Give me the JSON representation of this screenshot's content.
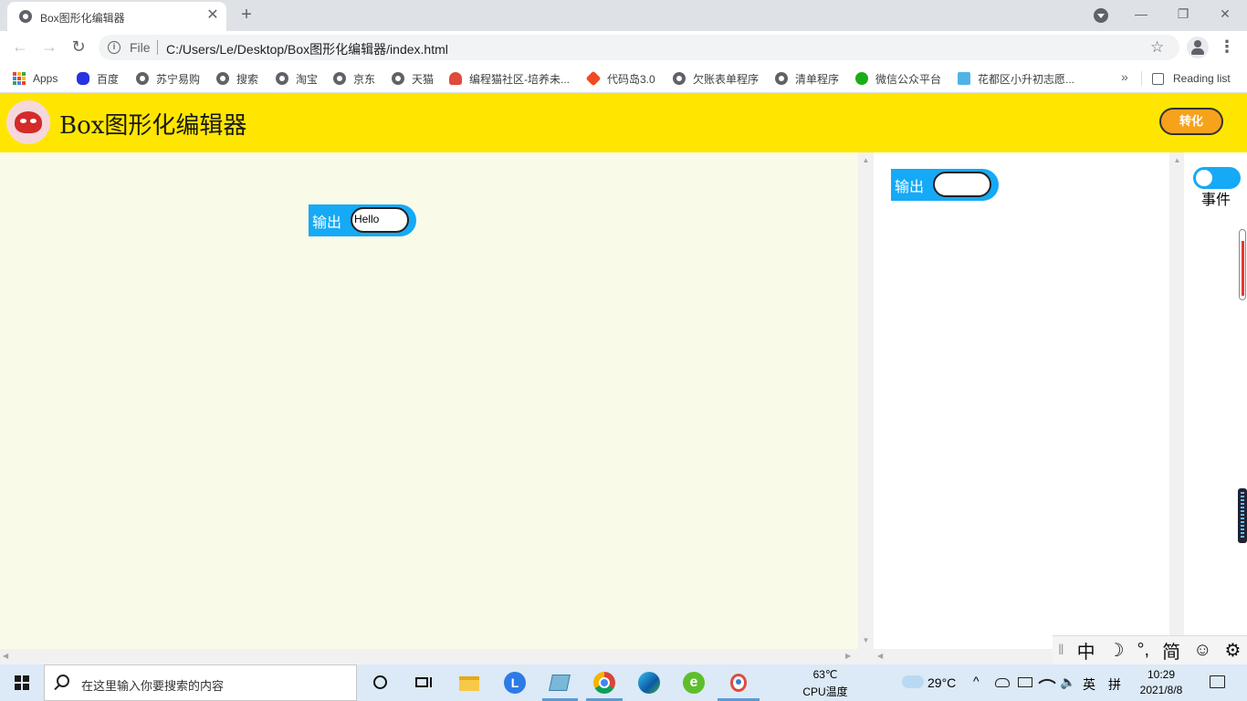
{
  "browser": {
    "tab_title": "Box图形化编辑器",
    "tab_close": "✕",
    "new_tab": "+",
    "win_minimize": "—",
    "win_restore": "❐",
    "win_close": "✕",
    "back": "←",
    "forward": "→",
    "reload": "↻",
    "omnibox": {
      "scheme": "File",
      "url": "C:/Users/Le/Desktop/Box图形化编辑器/index.html",
      "star": "☆"
    },
    "menu": "⋮"
  },
  "bookmarks": {
    "items": [
      {
        "label": "Apps",
        "icon": "apps-grid-icon"
      },
      {
        "label": "百度",
        "icon": "baidu-paw-icon"
      },
      {
        "label": "苏宁易购",
        "icon": "globe-icon"
      },
      {
        "label": "搜索",
        "icon": "globe-icon"
      },
      {
        "label": "淘宝",
        "icon": "globe-icon"
      },
      {
        "label": "京东",
        "icon": "globe-icon"
      },
      {
        "label": "天猫",
        "icon": "globe-icon"
      },
      {
        "label": "编程猫社区-培养未...",
        "icon": "codemao-icon"
      },
      {
        "label": "代码岛3.0",
        "icon": "codeisland-icon"
      },
      {
        "label": "欠账表单程序",
        "icon": "globe-icon"
      },
      {
        "label": "清单程序",
        "icon": "globe-icon"
      },
      {
        "label": "微信公众平台",
        "icon": "wechat-icon"
      },
      {
        "label": "花都区小升初志愿...",
        "icon": "cube-icon"
      }
    ],
    "overflow": "»",
    "reading_list": "Reading list"
  },
  "app": {
    "title": "Box图形化编辑器",
    "convert_button": "转化",
    "canvas_block": {
      "label": "输出",
      "value": "Hello"
    },
    "props_block": {
      "label": "输出",
      "value": ""
    },
    "event_label": "事件",
    "event_toggle_on": true
  },
  "ime": {
    "items": [
      "中",
      "☽",
      "°,",
      "简",
      "☺",
      "⚙"
    ]
  },
  "taskbar": {
    "search_placeholder": "在这里输入你要搜索的内容",
    "cpu_temp": "63℃",
    "cpu_label": "CPU温度",
    "weather": "29°C",
    "lang": "英",
    "ime_mode": "拼",
    "time": "10:29",
    "date": "2021/8/8",
    "colors": {
      "accent": "#5b9bd5",
      "header": "#ffe600",
      "block": "#16a9f5",
      "convert": "#f7a21b"
    }
  }
}
